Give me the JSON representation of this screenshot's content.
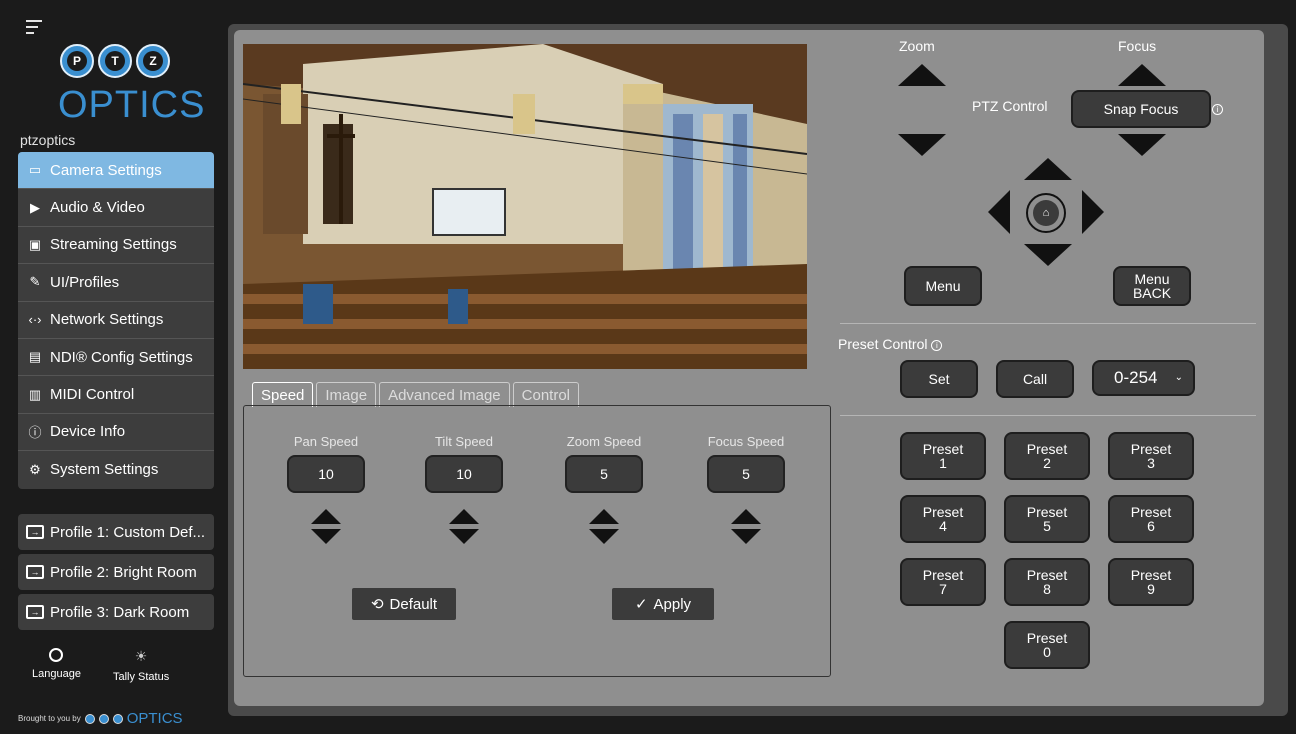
{
  "sidebar": {
    "brand_small": "ptzoptics",
    "logo_letters": [
      "P",
      "T",
      "Z"
    ],
    "logo_word": "OPTICS",
    "nav": [
      {
        "label": "Camera Settings",
        "icon": "camera-icon",
        "glyph": "▭",
        "active": true
      },
      {
        "label": "Audio & Video",
        "icon": "audio-video-icon",
        "glyph": "▶"
      },
      {
        "label": "Streaming Settings",
        "icon": "streaming-icon",
        "glyph": "▣"
      },
      {
        "label": "UI/Profiles",
        "icon": "palette-icon",
        "glyph": "✎"
      },
      {
        "label": "Network Settings",
        "icon": "network-icon",
        "glyph": "‹·›"
      },
      {
        "label": "NDI® Config Settings",
        "icon": "ndi-icon",
        "glyph": "▤"
      },
      {
        "label": "MIDI Control",
        "icon": "midi-icon",
        "glyph": "▥"
      },
      {
        "label": "Device Info",
        "icon": "info-icon",
        "glyph": "ⓘ"
      },
      {
        "label": "System Settings",
        "icon": "gear-icon",
        "glyph": "⚙"
      }
    ],
    "profiles": [
      "Profile 1: Custom Def...",
      "Profile 2: Bright Room",
      "Profile 3: Dark Room"
    ],
    "language_label": "Language",
    "tally_label": "Tally Status",
    "brought_by": "Brought to you by",
    "footer_word": "OPTICS"
  },
  "tabs": [
    "Speed",
    "Image",
    "Advanced Image",
    "Control"
  ],
  "speed": {
    "columns": [
      {
        "label": "Pan Speed",
        "value": "10"
      },
      {
        "label": "Tilt Speed",
        "value": "10"
      },
      {
        "label": "Zoom Speed",
        "value": "5"
      },
      {
        "label": "Focus Speed",
        "value": "5"
      }
    ],
    "default_label": "Default",
    "apply_label": "Apply"
  },
  "ptz": {
    "zoom_label": "Zoom",
    "focus_label": "Focus",
    "control_label": "PTZ Control",
    "snap_focus_label": "Snap Focus",
    "menu_label": "Menu",
    "menu_back_label": "Menu\nBACK",
    "home_glyph": "⌂"
  },
  "preset": {
    "title": "Preset Control",
    "set_label": "Set",
    "call_label": "Call",
    "range_value": "0-254",
    "preset_word": "Preset",
    "numbers": [
      "1",
      "2",
      "3",
      "4",
      "5",
      "6",
      "7",
      "8",
      "9",
      "0"
    ]
  }
}
